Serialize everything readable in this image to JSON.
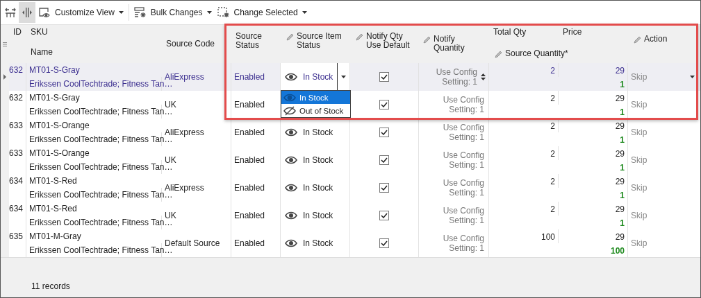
{
  "toolbar": {
    "buttons": [
      {
        "kind": "columns",
        "selected": false
      },
      {
        "kind": "split",
        "selected": true
      },
      {
        "kind": "customize",
        "label": "Customize View",
        "selected": false
      },
      {
        "kind": "bulk",
        "label": "Bulk Changes",
        "selected": false
      },
      {
        "kind": "change",
        "label": "Change Selected",
        "selected": false
      }
    ]
  },
  "columns": [
    {
      "label": "ID",
      "editable": false
    },
    {
      "label": "SKU",
      "editable": false
    },
    {
      "label": "Source Code",
      "editable": false
    },
    {
      "label": "Source Status",
      "editable": false
    },
    {
      "label": "Source Item Status",
      "editable": true
    },
    {
      "label": "Notify Qty Use Default",
      "editable": true
    },
    {
      "label": "Notify Quantity",
      "editable": true
    },
    {
      "label": "Total Qty",
      "editable": false
    },
    {
      "label": "Price",
      "editable": false
    },
    {
      "label": "Action",
      "editable": true
    },
    {
      "label": "Name",
      "editable": false
    },
    {
      "label": "Source Quantity*",
      "editable": true
    }
  ],
  "rows": [
    {
      "id": "632",
      "sku": "MT01-S-Gray",
      "name": "Erikssen CoolTechtrade; Fitness Tan…",
      "source_code": "AliExpress",
      "source_status": "Enabled",
      "item_status": "In Stock",
      "notify_use_default": true,
      "notify_quantity": "Use Config Setting: 1",
      "total_qty": "2",
      "price": "29",
      "source_quantity": "1",
      "action": "Skip",
      "selected": true,
      "editing": true,
      "dropdown": [
        {
          "label": "In Stock",
          "kind": "in_stock",
          "selected": true
        },
        {
          "label": "Out of Stock",
          "kind": "out_of_stock",
          "selected": false
        }
      ]
    },
    {
      "id": "632",
      "sku": "MT01-S-Gray",
      "name": "Erikssen CoolTechtrade; Fitness Tan…",
      "source_code": "UK",
      "source_status": "Enabled",
      "notify_use_default": true,
      "notify_quantity": "Use Config Setting: 1",
      "total_qty": "2",
      "price": "29",
      "source_quantity": "1",
      "action": "Skip",
      "selected": false,
      "editing": false
    },
    {
      "id": "633",
      "sku": "MT01-S-Orange",
      "name": "Erikssen CoolTechtrade; Fitness Tan…",
      "source_code": "AliExpress",
      "source_status": "Enabled",
      "item_status": "In Stock",
      "notify_use_default": true,
      "notify_quantity": "Use Config Setting: 1",
      "total_qty": "2",
      "price": "29",
      "source_quantity": "1",
      "action": "Skip",
      "selected": false,
      "editing": false
    },
    {
      "id": "633",
      "sku": "MT01-S-Orange",
      "name": "Erikssen CoolTechtrade; Fitness Tan…",
      "source_code": "UK",
      "source_status": "Enabled",
      "item_status": "In Stock",
      "notify_use_default": true,
      "notify_quantity": "Use Config Setting: 1",
      "total_qty": "2",
      "price": "29",
      "source_quantity": "1",
      "action": "Skip",
      "selected": false,
      "editing": false
    },
    {
      "id": "634",
      "sku": "MT01-S-Red",
      "name": "Erikssen CoolTechtrade; Fitness Tan…",
      "source_code": "AliExpress",
      "source_status": "Enabled",
      "item_status": "In Stock",
      "notify_use_default": true,
      "notify_quantity": "Use Config Setting: 1",
      "total_qty": "2",
      "price": "29",
      "source_quantity": "1",
      "action": "Skip",
      "selected": false,
      "editing": false
    },
    {
      "id": "634",
      "sku": "MT01-S-Red",
      "name": "Erikssen CoolTechtrade; Fitness Tan…",
      "source_code": "UK",
      "source_status": "Enabled",
      "item_status": "In Stock",
      "notify_use_default": true,
      "notify_quantity": "Use Config Setting: 1",
      "total_qty": "2",
      "price": "29",
      "source_quantity": "1",
      "action": "Skip",
      "selected": false,
      "editing": false
    },
    {
      "id": "635",
      "sku": "MT01-M-Gray",
      "name": "Erikssen CoolTechtrade; Fitness Tan…",
      "source_code": "Default Source",
      "source_status": "Enabled",
      "item_status": "In Stock",
      "notify_use_default": true,
      "notify_quantity": "Use Config Setting: 1",
      "total_qty": "100",
      "price": "29",
      "source_quantity": "100",
      "action": "Skip",
      "selected": false,
      "editing": false
    }
  ],
  "highlight": {
    "kind": "frame"
  },
  "status_bar": {
    "records": "11 records"
  }
}
